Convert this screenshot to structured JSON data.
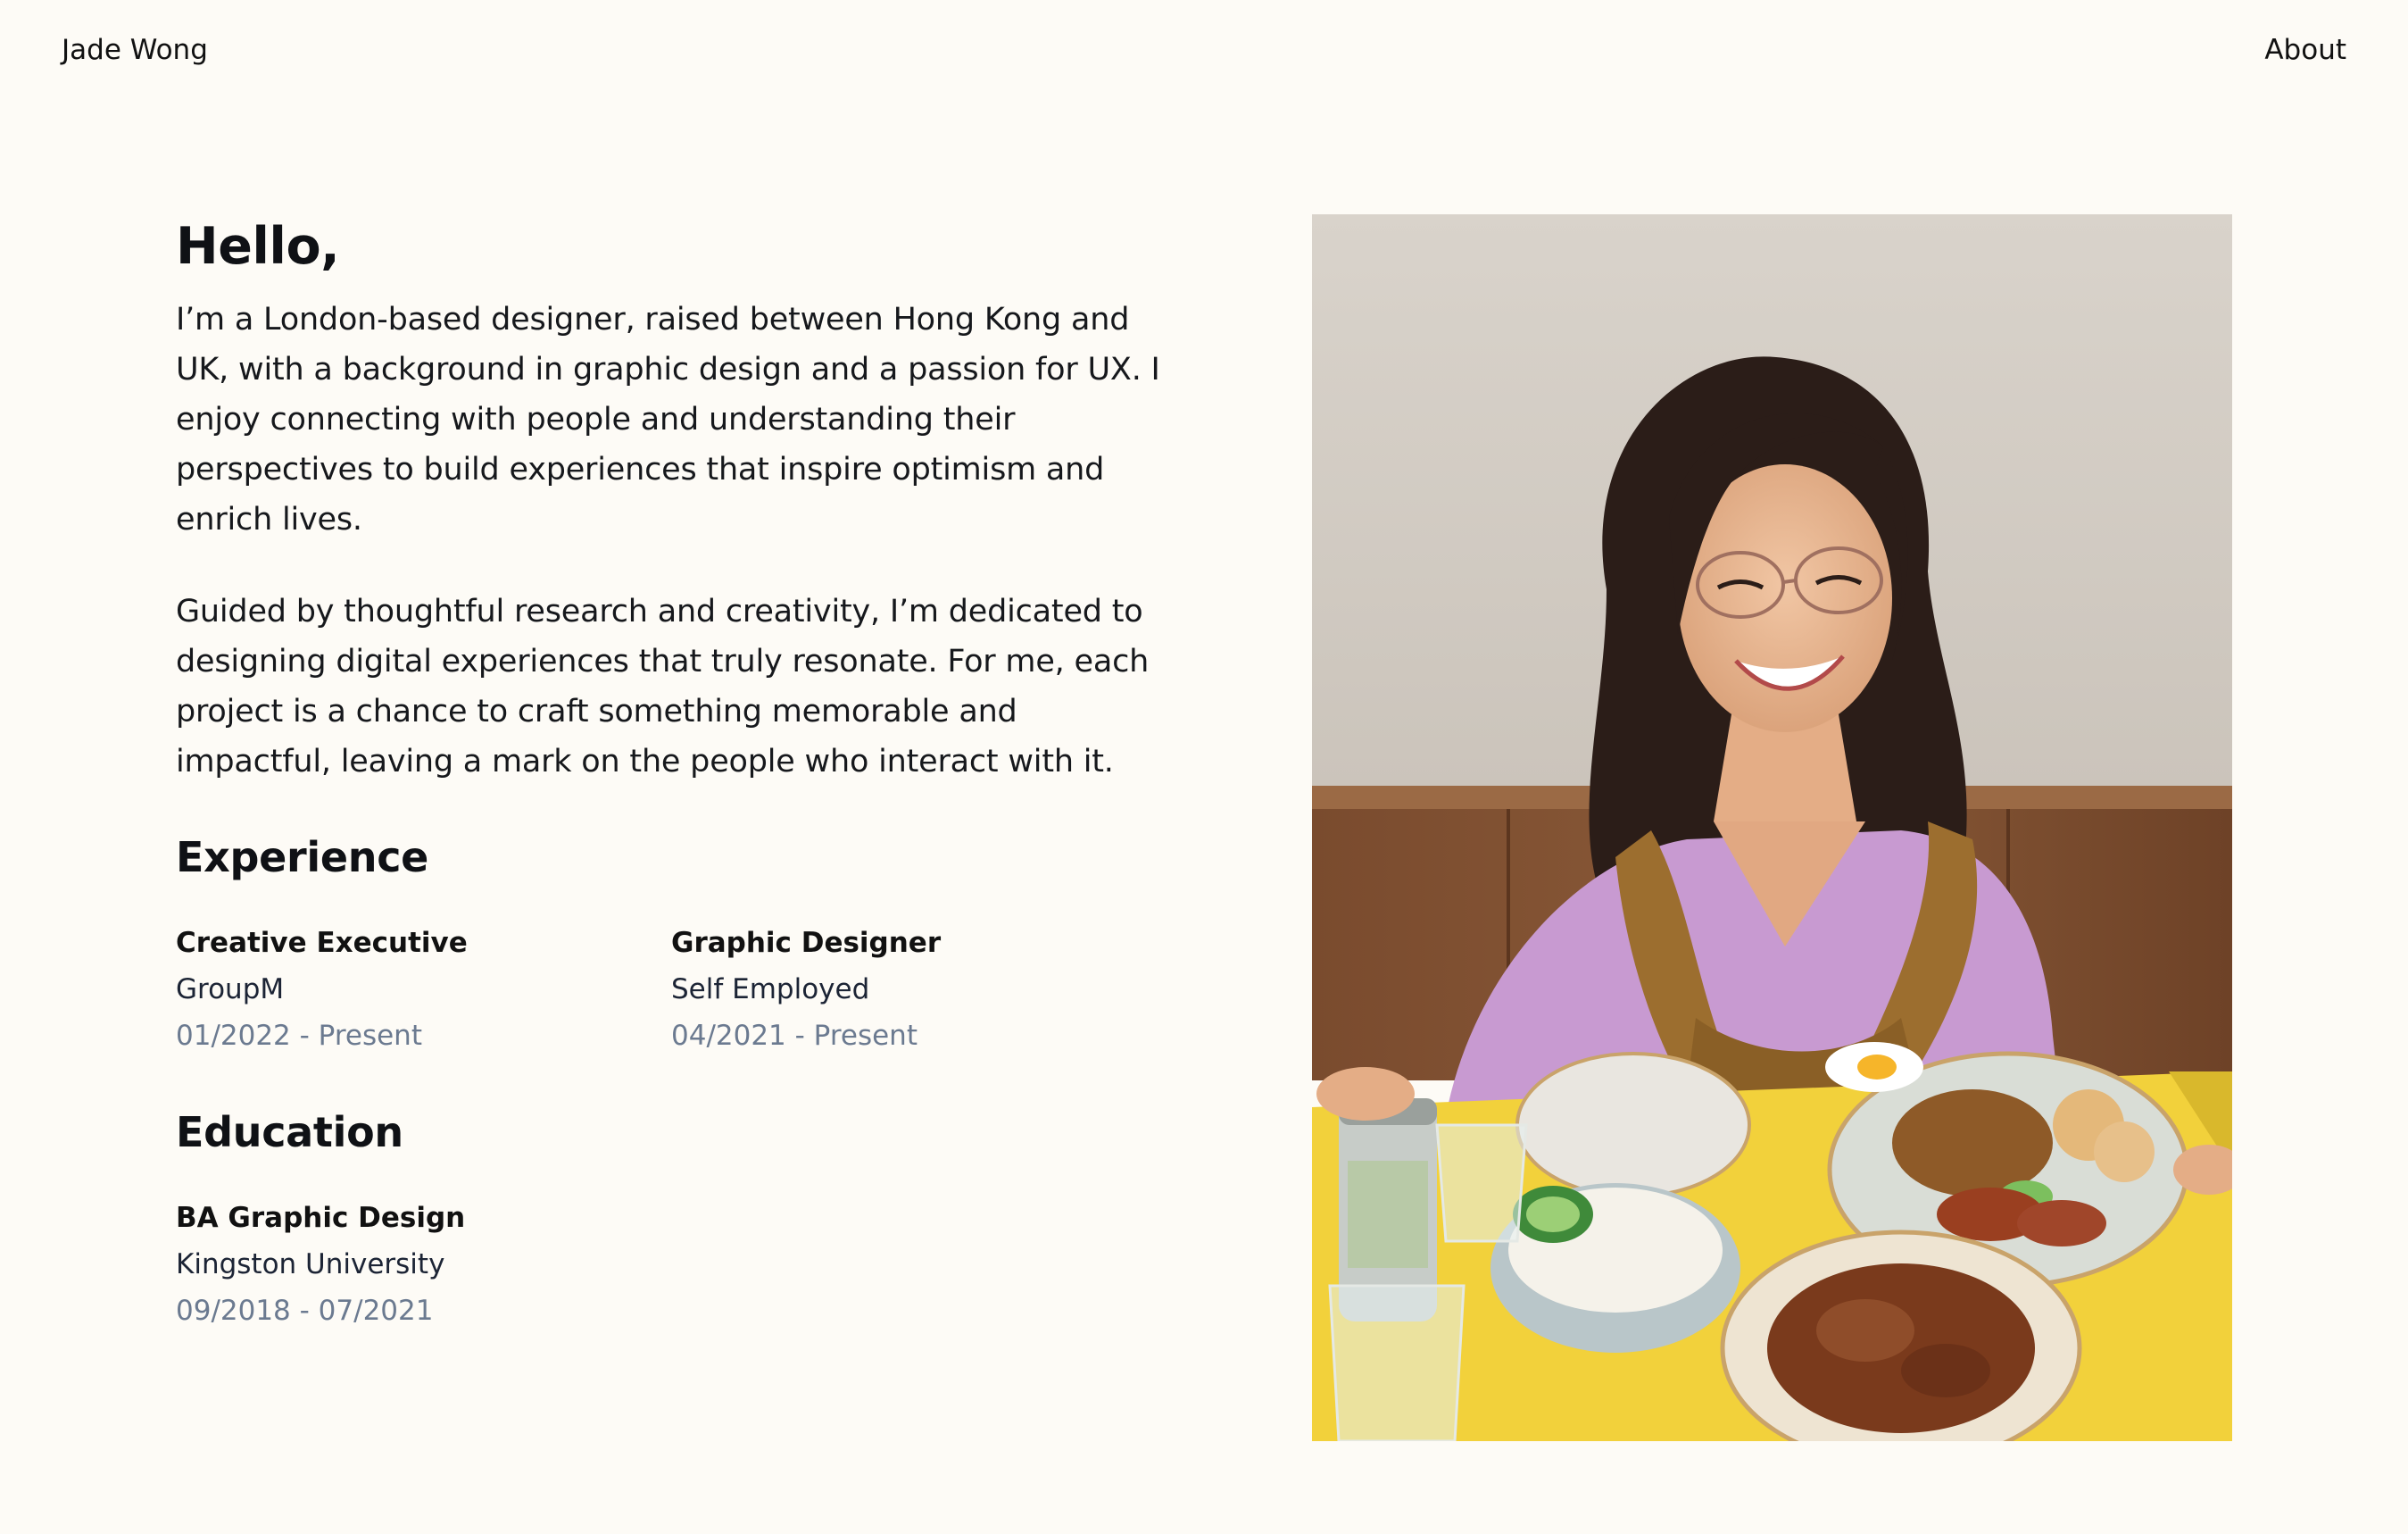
{
  "header": {
    "site_name": "Jade Wong",
    "nav_about": "About"
  },
  "intro": {
    "greeting": "Hello,",
    "paragraphs": [
      "I’m a London-based designer, raised between Hong Kong and UK, with a background in graphic design and a passion for UX. I enjoy connecting with people and understanding their perspectives to build experiences that inspire optimism and enrich lives.",
      "Guided by thoughtful research and creativity, I’m dedicated to designing digital experiences that truly resonate. For me, each project is a chance to craft something memorable and impactful, leaving a mark on the people who interact with it."
    ]
  },
  "experience": {
    "heading": "Experience",
    "items": [
      {
        "title": "Creative Executive",
        "organization": "GroupM",
        "dates": "01/2022 - Present"
      },
      {
        "title": "Graphic Designer",
        "organization": "Self Employed",
        "dates": "04/2021 - Present"
      }
    ]
  },
  "education": {
    "heading": "Education",
    "items": [
      {
        "title": "BA Graphic Design",
        "organization": "Kingston University",
        "dates": "09/2018 - 07/2021"
      }
    ]
  },
  "colors": {
    "background": "#fdfbf6",
    "text": "#0f1115",
    "organization": "#1c2435",
    "dates": "#6b7a90",
    "table_yellow": "#f2d13b"
  }
}
